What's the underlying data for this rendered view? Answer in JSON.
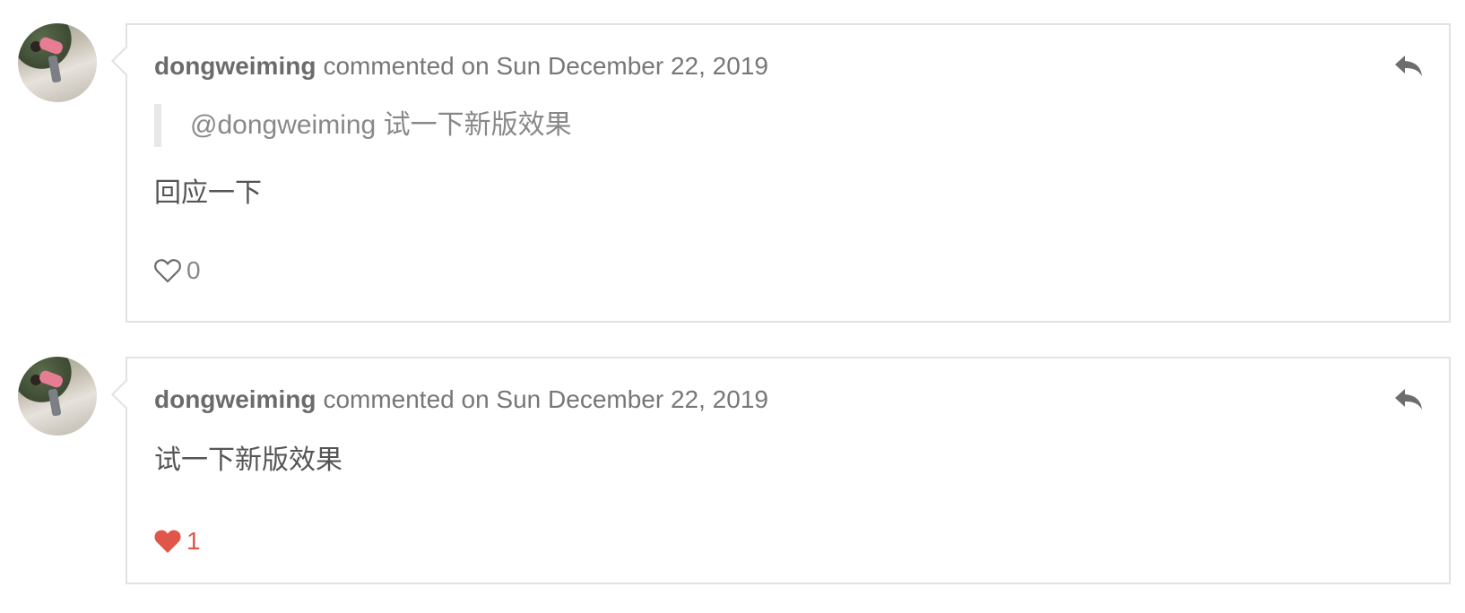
{
  "comments": [
    {
      "author": "dongweiming",
      "meta": "commented on Sun December 22, 2019",
      "quote": "@dongweiming 试一下新版效果",
      "body": "回应一下",
      "likes": "0",
      "liked": false
    },
    {
      "author": "dongweiming",
      "meta": "commented on Sun December 22, 2019",
      "body": "试一下新版效果",
      "likes": "1",
      "liked": true
    }
  ],
  "colors": {
    "border": "#e2e2e2",
    "like_active": "#e0574a",
    "text": "#555555",
    "meta": "#777777"
  },
  "icons": {
    "reply": "reply-arrow-icon",
    "like_empty": "heart-outline-icon",
    "like_filled": "heart-filled-icon"
  }
}
